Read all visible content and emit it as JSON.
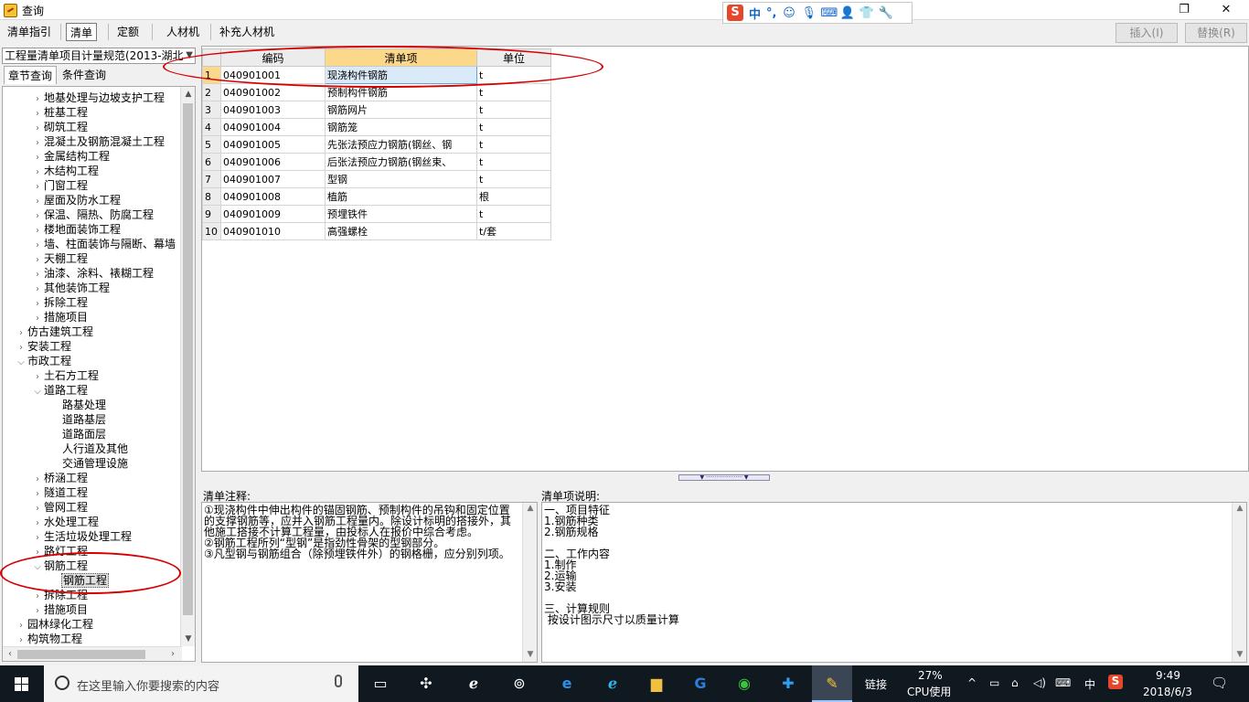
{
  "window": {
    "title": "查询",
    "restore_icon": "restore-icon",
    "close_icon": "close-icon"
  },
  "ime": {
    "lang": "中",
    "punct": "°,"
  },
  "menu": {
    "tabs": [
      "清单指引",
      "清单",
      "定额",
      "人材机",
      "补充人材机"
    ],
    "active": 1,
    "insert_label": "插入(I)",
    "replace_label": "替换(R)"
  },
  "left": {
    "spec_value": "工程量清单项目计量规范(2013-湖北",
    "tabs": [
      "章节查询",
      "条件查询"
    ],
    "tree": [
      {
        "label": "地基处理与边坡支护工程",
        "level": 1,
        "arrow": ">"
      },
      {
        "label": "桩基工程",
        "level": 1,
        "arrow": ">"
      },
      {
        "label": "砌筑工程",
        "level": 1,
        "arrow": ">"
      },
      {
        "label": "混凝土及钢筋混凝土工程",
        "level": 1,
        "arrow": ">"
      },
      {
        "label": "金属结构工程",
        "level": 1,
        "arrow": ">"
      },
      {
        "label": "木结构工程",
        "level": 1,
        "arrow": ">"
      },
      {
        "label": "门窗工程",
        "level": 1,
        "arrow": ">"
      },
      {
        "label": "屋面及防水工程",
        "level": 1,
        "arrow": ">"
      },
      {
        "label": "保温、隔热、防腐工程",
        "level": 1,
        "arrow": ">"
      },
      {
        "label": "楼地面装饰工程",
        "level": 1,
        "arrow": ">"
      },
      {
        "label": "墙、柱面装饰与隔断、幕墙",
        "level": 1,
        "arrow": ">"
      },
      {
        "label": "天棚工程",
        "level": 1,
        "arrow": ">"
      },
      {
        "label": "油漆、涂料、裱糊工程",
        "level": 1,
        "arrow": ">"
      },
      {
        "label": "其他装饰工程",
        "level": 1,
        "arrow": ">"
      },
      {
        "label": "拆除工程",
        "level": 1,
        "arrow": ">"
      },
      {
        "label": "措施项目",
        "level": 1,
        "arrow": ">"
      },
      {
        "label": "仿古建筑工程",
        "level": 0,
        "arrow": ">"
      },
      {
        "label": "安装工程",
        "level": 0,
        "arrow": ">"
      },
      {
        "label": "市政工程",
        "level": 0,
        "arrow": "v"
      },
      {
        "label": "土石方工程",
        "level": 1,
        "arrow": ">"
      },
      {
        "label": "道路工程",
        "level": 1,
        "arrow": "v"
      },
      {
        "label": "路基处理",
        "level": 2,
        "arrow": ""
      },
      {
        "label": "道路基层",
        "level": 2,
        "arrow": ""
      },
      {
        "label": "道路面层",
        "level": 2,
        "arrow": ""
      },
      {
        "label": "人行道及其他",
        "level": 2,
        "arrow": ""
      },
      {
        "label": "交通管理设施",
        "level": 2,
        "arrow": ""
      },
      {
        "label": "桥涵工程",
        "level": 1,
        "arrow": ">"
      },
      {
        "label": "隧道工程",
        "level": 1,
        "arrow": ">"
      },
      {
        "label": "管网工程",
        "level": 1,
        "arrow": ">"
      },
      {
        "label": "水处理工程",
        "level": 1,
        "arrow": ">"
      },
      {
        "label": "生活垃圾处理工程",
        "level": 1,
        "arrow": ">"
      },
      {
        "label": "路灯工程",
        "level": 1,
        "arrow": ">"
      },
      {
        "label": "钢筋工程",
        "level": 1,
        "arrow": "v"
      },
      {
        "label": "钢筋工程",
        "level": 2,
        "arrow": "",
        "selected": true
      },
      {
        "label": "拆除工程",
        "level": 1,
        "arrow": ">"
      },
      {
        "label": "措施项目",
        "level": 1,
        "arrow": ">"
      },
      {
        "label": "园林绿化工程",
        "level": 0,
        "arrow": ">"
      },
      {
        "label": "构筑物工程",
        "level": 0,
        "arrow": ">"
      }
    ]
  },
  "grid": {
    "headers": [
      "编码",
      "清单项",
      "单位"
    ],
    "rows": [
      {
        "n": "1",
        "code": "040901001",
        "name": "现浇构件钢筋",
        "unit": "t"
      },
      {
        "n": "2",
        "code": "040901002",
        "name": "预制构件钢筋",
        "unit": "t"
      },
      {
        "n": "3",
        "code": "040901003",
        "name": "钢筋网片",
        "unit": "t"
      },
      {
        "n": "4",
        "code": "040901004",
        "name": "钢筋笼",
        "unit": "t"
      },
      {
        "n": "5",
        "code": "040901005",
        "name": "先张法预应力钢筋(钢丝、钢",
        "unit": "t"
      },
      {
        "n": "6",
        "code": "040901006",
        "name": "后张法预应力钢筋(钢丝束、",
        "unit": "t"
      },
      {
        "n": "7",
        "code": "040901007",
        "name": "型钢",
        "unit": "t"
      },
      {
        "n": "8",
        "code": "040901008",
        "name": "植筋",
        "unit": "根"
      },
      {
        "n": "9",
        "code": "040901009",
        "name": "预埋铁件",
        "unit": "t"
      },
      {
        "n": "10",
        "code": "040901010",
        "name": "高强螺栓",
        "unit": "t/套"
      }
    ]
  },
  "notes": {
    "label": "清单注释:",
    "lines": [
      "①现浇构件中伸出构件的锚固钢筋、预制构件的吊钩和固定位置",
      "的支撑钢筋等，应并入钢筋工程量内。除设计标明的搭接外，其",
      "他施工搭接不计算工程量，由投标人在报价中综合考虑。",
      "②钢筋工程所列“型钢”是指劲性骨架的型钢部分。",
      "③凡型钢与钢筋组合（除预埋铁件外）的钢格栅，应分别列项。"
    ]
  },
  "desc": {
    "label": "清单项说明:",
    "lines": [
      "一、项目特征",
      "1.钢筋种类",
      "2.钢筋规格",
      "",
      "二、工作内容",
      "1.制作",
      "2.运输",
      "3.安装",
      "",
      "三、计算规则",
      " 按设计图示尺寸以质量计算"
    ]
  },
  "taskbar": {
    "search_placeholder": "在这里输入你要搜索的内容",
    "link_label": "链接",
    "cpu_percent": "27%",
    "cpu_label": "CPU使用",
    "ime_lang": "中",
    "time": "9:49",
    "date": "2018/6/3"
  }
}
